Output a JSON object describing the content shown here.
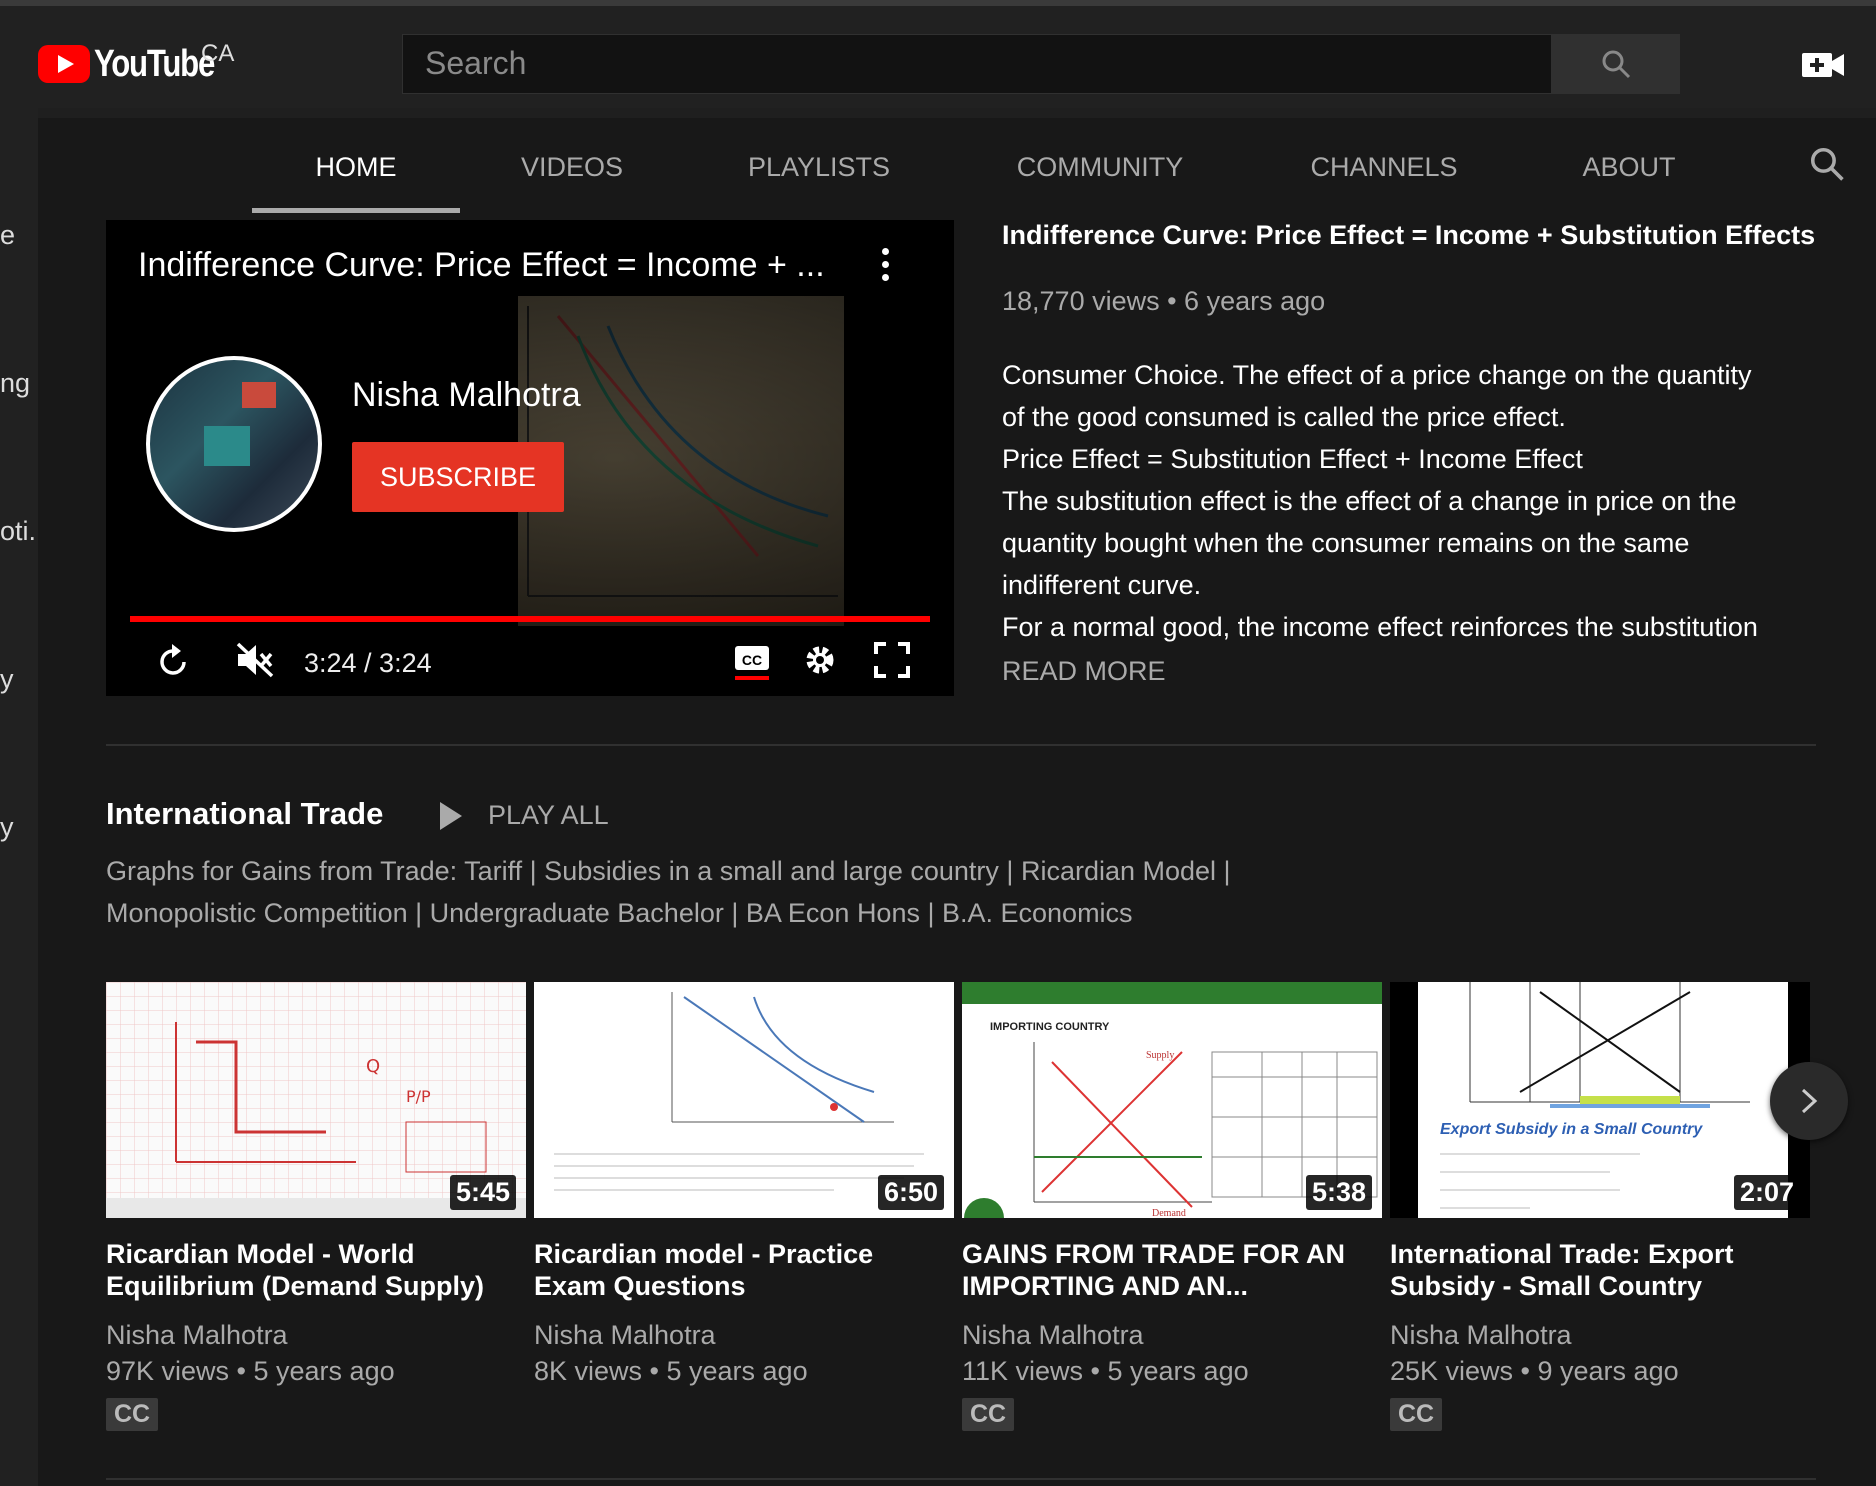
{
  "header": {
    "logo_text": "YouTube",
    "region": "CA",
    "search_placeholder": "Search"
  },
  "tabs": [
    "HOME",
    "VIDEOS",
    "PLAYLISTS",
    "COMMUNITY",
    "CHANNELS",
    "ABOUT"
  ],
  "active_tab": "HOME",
  "sidebar_fragments": [
    "e",
    "ng",
    "oti...",
    "y",
    "y"
  ],
  "player": {
    "overlay_title": "Indifference Curve: Price Effect = Income + ...",
    "channel_name": "Nisha Malhotra",
    "subscribe_label": "SUBSCRIBE",
    "time": "3:24 / 3:24",
    "progress": 1.0
  },
  "featured": {
    "title": "Indifference Curve: Price Effect = Income + Substitution Effects",
    "meta": "18,770 views • 6 years ago",
    "description_lines": [
      "Consumer Choice. The effect of a price change on the quantity",
      "of the good consumed is called the price effect.",
      "Price Effect = Substitution Effect + Income Effect",
      "The substitution effect is the effect of a change in price on the",
      "quantity bought when the consumer remains on the same",
      "indifferent curve.",
      "For a normal good, the income effect reinforces the substitution"
    ],
    "read_more": "READ MORE"
  },
  "shelf": {
    "title": "International Trade",
    "play_all": "PLAY ALL",
    "description_lines": [
      "Graphs for Gains from Trade: Tariff | Subsidies in a small and large country | Ricardian Model |",
      "Monopolistic Competition | Undergraduate Bachelor | BA Econ Hons | B.A. Economics"
    ],
    "videos": [
      {
        "title_line1": "Ricardian Model - World",
        "title_line2": "Equilibrium (Demand Supply)",
        "channel": "Nisha Malhotra",
        "meta": "97K views • 5 years ago",
        "duration": "5:45",
        "badge": "CC"
      },
      {
        "title_line1": "Ricardian model - Practice",
        "title_line2": "Exam Questions",
        "channel": "Nisha Malhotra",
        "meta": "8K views • 5 years ago",
        "duration": "6:50",
        "badge": ""
      },
      {
        "title_line1": "GAINS FROM TRADE FOR AN",
        "title_line2": "IMPORTING AND AN...",
        "channel": "Nisha Malhotra",
        "meta": "11K views • 5 years ago",
        "duration": "5:38",
        "badge": "CC"
      },
      {
        "title_line1": "International Trade: Export",
        "title_line2": "Subsidy - Small Country",
        "channel": "Nisha Malhotra",
        "meta": "25K views • 9 years ago",
        "duration": "2:07",
        "badge": "CC"
      }
    ]
  },
  "thumb_text": {
    "t3_heading": "IMPORTING COUNTRY",
    "t3_supply": "Supply",
    "t3_demand": "Demand",
    "t4_caption": "Export Subsidy in a Small Country"
  },
  "colors": {
    "accent": "#ff0000",
    "subscribe": "#e53424",
    "background": "#181818"
  }
}
